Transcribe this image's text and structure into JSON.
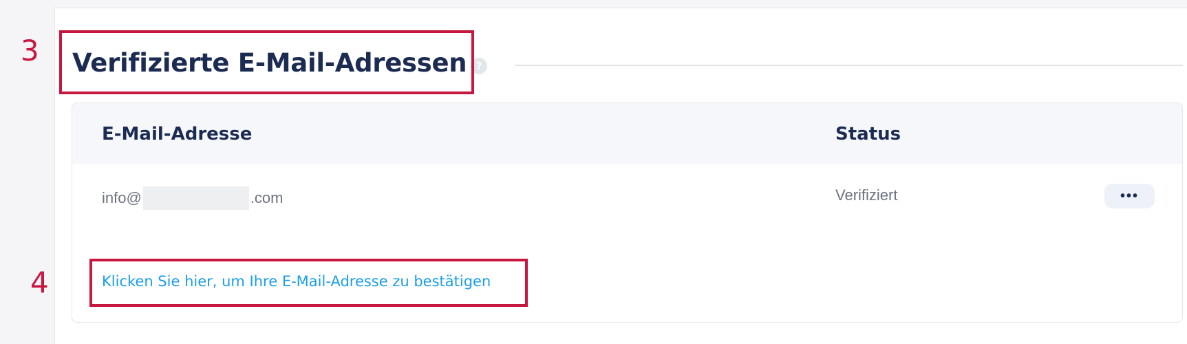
{
  "annotations": {
    "step_heading": "3",
    "step_link": "4",
    "highlight_color": "#c8173f"
  },
  "section": {
    "title": "Verifizierte E-Mail-Adressen",
    "help_icon": "question-icon",
    "help_glyph": "?"
  },
  "table": {
    "columns": [
      "E-Mail-Adresse",
      "Status"
    ],
    "rows": [
      {
        "email_prefix": "info@",
        "email_suffix": ".com",
        "status": "Verifiziert",
        "more_icon": "more-horizontal-icon",
        "more_glyph": "•••"
      }
    ]
  },
  "confirm_link": "Klicken Sie hier, um Ihre E-Mail-Adresse zu bestätigen",
  "colors": {
    "title": "#1c2b52",
    "link": "#1a9ee6",
    "muted_text": "#6b7280"
  }
}
